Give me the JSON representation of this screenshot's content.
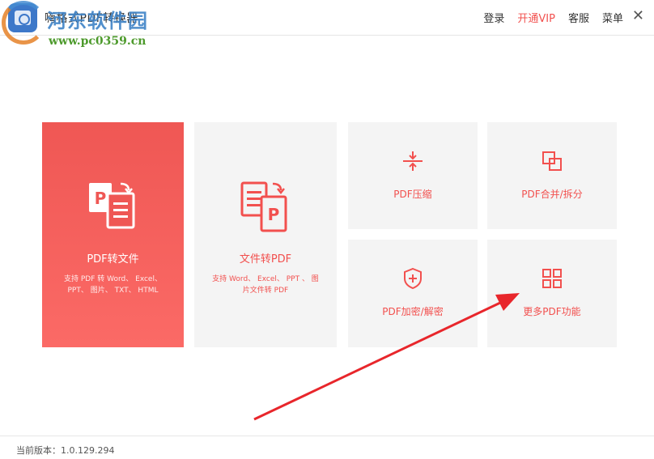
{
  "window": {
    "title": "嗨格式PDF转换器",
    "nav": [
      {
        "label": "登录"
      },
      {
        "label": "开通VIP"
      },
      {
        "label": "客服"
      },
      {
        "label": "菜单"
      }
    ],
    "close_glyph": "✕"
  },
  "watermark": {
    "name": "河东软件园",
    "url": "www.pc0359.cn"
  },
  "tiles": {
    "pdf_to_file": {
      "title": "PDF转文件",
      "desc": "支持 PDF 转 Word、 Excel、 PPT、 图片、 TXT、 HTML"
    },
    "file_to_pdf": {
      "title": "文件转PDF",
      "desc": "支持 Word、 Excel、 PPT 、 图片文件转 PDF"
    },
    "compress": {
      "title": "PDF压缩"
    },
    "merge": {
      "title": "PDF合并/拆分"
    },
    "encrypt": {
      "title": "PDF加密/解密"
    },
    "more": {
      "title": "更多PDF功能"
    }
  },
  "footer": {
    "version": "当前版本：1.0.129.294"
  },
  "colors": {
    "accent": "#f2504e",
    "tile_bg": "#f4f4f4",
    "annotation_arrow": "#e8262b"
  },
  "icons": {
    "app": "app-logo-icon",
    "pdf_to_file": "pdf-to-document-icon",
    "file_to_pdf": "document-to-pdf-icon",
    "compress": "compress-icon",
    "merge": "merge-split-icon",
    "encrypt": "shield-plus-icon",
    "more": "grid-icon"
  }
}
